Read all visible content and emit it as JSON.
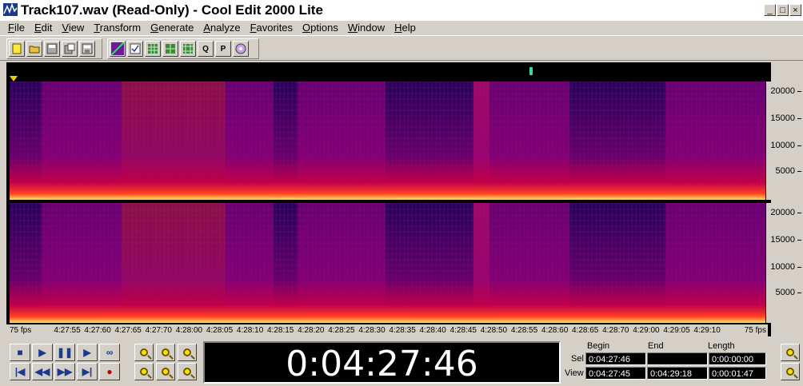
{
  "window": {
    "title": "Track107.wav (Read-Only) - Cool Edit 2000 Lite",
    "minimize": "_",
    "maximize": "□",
    "close": "×"
  },
  "menu": [
    "File",
    "Edit",
    "View",
    "Transform",
    "Generate",
    "Analyze",
    "Favorites",
    "Options",
    "Window",
    "Help"
  ],
  "toolbar": {
    "group1": [
      "new-icon",
      "open-icon",
      "save-icon",
      "save-as-icon",
      "save-all-icon"
    ],
    "group2": [
      "spectral-view-icon",
      "check-icon",
      "grid-a-icon",
      "grid-b-icon",
      "grid-c-icon",
      "document-q-icon",
      "document-p-icon",
      "cd-icon"
    ],
    "doc_q_label": "Q",
    "doc_p_label": "P"
  },
  "frequency_scale": {
    "unit_labels": [
      "20000",
      "15000",
      "10000",
      "5000"
    ]
  },
  "timeline": {
    "left_edge": "75 fps",
    "right_edge": "75 fps",
    "ticks": [
      "4:27:55",
      "4:27:60",
      "4:27:65",
      "4:27:70",
      "4:28:00",
      "4:28:05",
      "4:28:10",
      "4:28:15",
      "4:28:20",
      "4:28:25",
      "4:28:30",
      "4:28:35",
      "4:28:40",
      "4:28:45",
      "4:28:50",
      "4:28:55",
      "4:28:60",
      "4:28:65",
      "4:28:70",
      "4:29:00",
      "4:29:05",
      "4:29:10"
    ]
  },
  "transport": {
    "buttons": [
      "stop-icon",
      "play-icon",
      "pause-icon",
      "play-to-end-icon",
      "loop-icon",
      "go-to-start-icon",
      "rewind-icon",
      "fast-forward-icon",
      "go-to-end-icon",
      "record-icon"
    ],
    "symbols": [
      "■",
      "▶",
      "❚❚",
      "▶",
      "∞",
      "|◀",
      "◀◀",
      "▶▶",
      "▶|",
      "●"
    ]
  },
  "time_display": "0:04:27:46",
  "selection": {
    "headers": [
      "Begin",
      "End",
      "Length"
    ],
    "sel_label": "Sel",
    "view_label": "View",
    "sel_begin": "0:04:27:46",
    "sel_end": "",
    "sel_length": "0:00:00:00",
    "view_begin": "0:04:27:45",
    "view_end": "0:04:29:18",
    "view_length": "0:00:01:47"
  },
  "colors": {
    "spectrogram_low": "#2a0060",
    "spectrogram_mid": "#c0004a",
    "spectrogram_high": "#ff4020",
    "spectrogram_peak": "#ffe060",
    "overview_marker": "#3fd7a0",
    "playhead": "#e8d000"
  }
}
